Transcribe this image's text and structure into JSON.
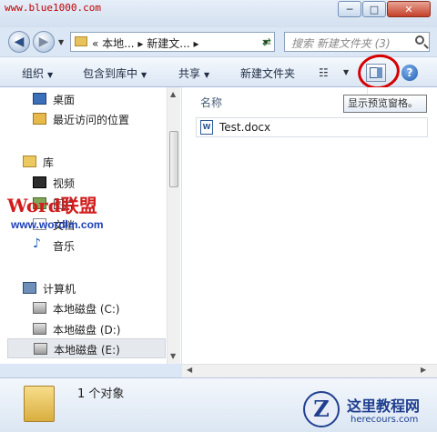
{
  "watermark_top": "www.blue1000.com",
  "window_controls": {
    "minimize": "─",
    "maximize": "□",
    "close": "✕"
  },
  "nav": {
    "back": "◀",
    "forward": "▶",
    "address": "« 本地... ▸ 新建文... ▸",
    "search_placeholder": "搜索 新建文件夹 (3)"
  },
  "toolbar": {
    "organize": "组织",
    "include_library": "包含到库中",
    "share": "共享",
    "new_folder": "新建文件夹",
    "dropdown_arrow": "▼"
  },
  "tooltip": "显示预览窗格。",
  "sidebar": {
    "desktop": "桌面",
    "recent": "最近访问的位置",
    "library": "库",
    "videos": "视频",
    "pictures": "图片",
    "documents": "文档",
    "music": "音乐",
    "computer": "计算机",
    "drive_c": "本地磁盘 (C:)",
    "drive_d": "本地磁盘 (D:)",
    "drive_e": "本地磁盘 (E:)"
  },
  "watermark_word": {
    "text": "Word联盟",
    "url": "www.wordlm.com"
  },
  "content": {
    "column_name": "名称",
    "files": [
      {
        "name": "Test.docx",
        "icon": "W"
      }
    ]
  },
  "details": {
    "object_count": "1 个对象"
  },
  "logo": {
    "glyph": "Z",
    "cn": "这里教程网",
    "en": "herecours.com"
  }
}
